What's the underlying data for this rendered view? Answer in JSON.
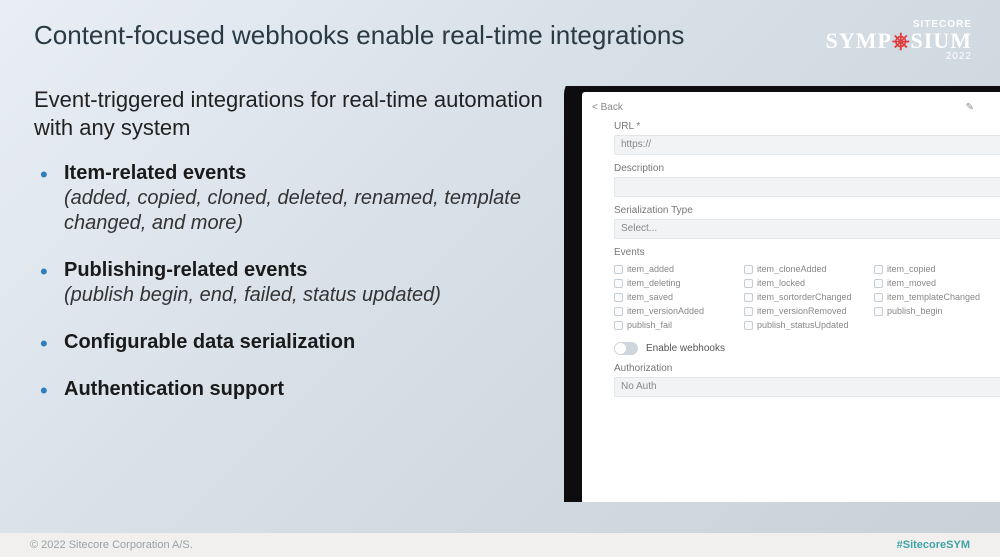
{
  "header": {
    "title": "Content-focused webhooks enable real-time integrations",
    "brand_top": "SITECORE",
    "brand_main_pre": "SYMP",
    "brand_main_post": "SIUM",
    "brand_year": "2022"
  },
  "subtitle": "Event-triggered integrations for real-time automation with any system",
  "bullets": [
    {
      "strong": "Item-related events",
      "italic": "(added, copied, cloned, deleted, renamed, template changed, and more)"
    },
    {
      "strong": "Publishing-related events",
      "italic": "(publish begin, end, failed, status updated)"
    },
    {
      "strong": "Configurable data serialization",
      "italic": ""
    },
    {
      "strong": "Authentication support",
      "italic": ""
    }
  ],
  "mock": {
    "back": "< Back",
    "url_label": "URL *",
    "url_value": "https://",
    "desc_label": "Description",
    "serial_label": "Serialization Type",
    "serial_value": "Select...",
    "events_label": "Events",
    "events": [
      [
        "item_added",
        "item_cloneAdded",
        "item_copied"
      ],
      [
        "item_deleting",
        "item_locked",
        "item_moved"
      ],
      [
        "item_saved",
        "item_sortorderChanged",
        "item_templateChanged"
      ],
      [
        "item_versionAdded",
        "item_versionRemoved",
        "publish_begin"
      ],
      [
        "publish_fail",
        "publish_statusUpdated",
        ""
      ]
    ],
    "toggle_label": "Enable webhooks",
    "auth_label": "Authorization",
    "auth_value": "No Auth"
  },
  "footer": {
    "left": "© 2022 Sitecore Corporation A/S.",
    "right": "#SitecoreSYM"
  }
}
